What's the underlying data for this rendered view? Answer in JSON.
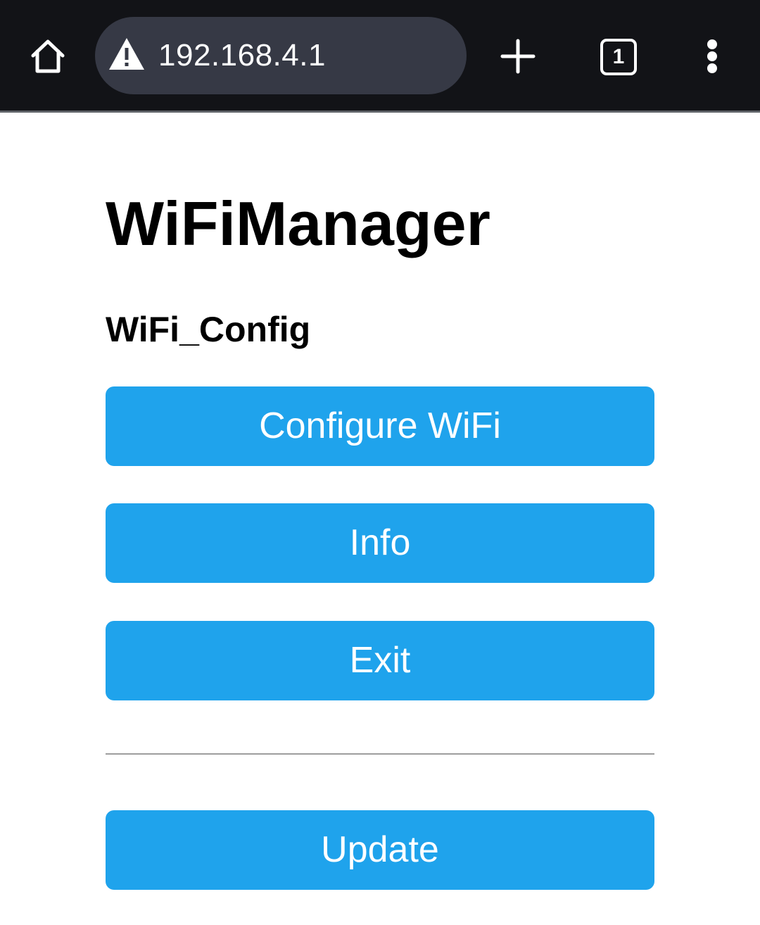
{
  "browser": {
    "url": "192.168.4.1",
    "tab_count": "1",
    "icons": {
      "home": "home-icon",
      "security": "warning-triangle-icon",
      "new_tab": "plus-icon",
      "tabs": "tab-switcher-icon",
      "menu": "more-vert-icon"
    }
  },
  "page": {
    "title": "WiFiManager",
    "subtitle": "WiFi_Config",
    "buttons": {
      "configure": "Configure WiFi",
      "info": "Info",
      "exit": "Exit",
      "update": "Update"
    }
  },
  "colors": {
    "toolbar": "#121317",
    "urlbar": "#363945",
    "button": "#1fa3ec",
    "button_text": "#ffffff"
  }
}
